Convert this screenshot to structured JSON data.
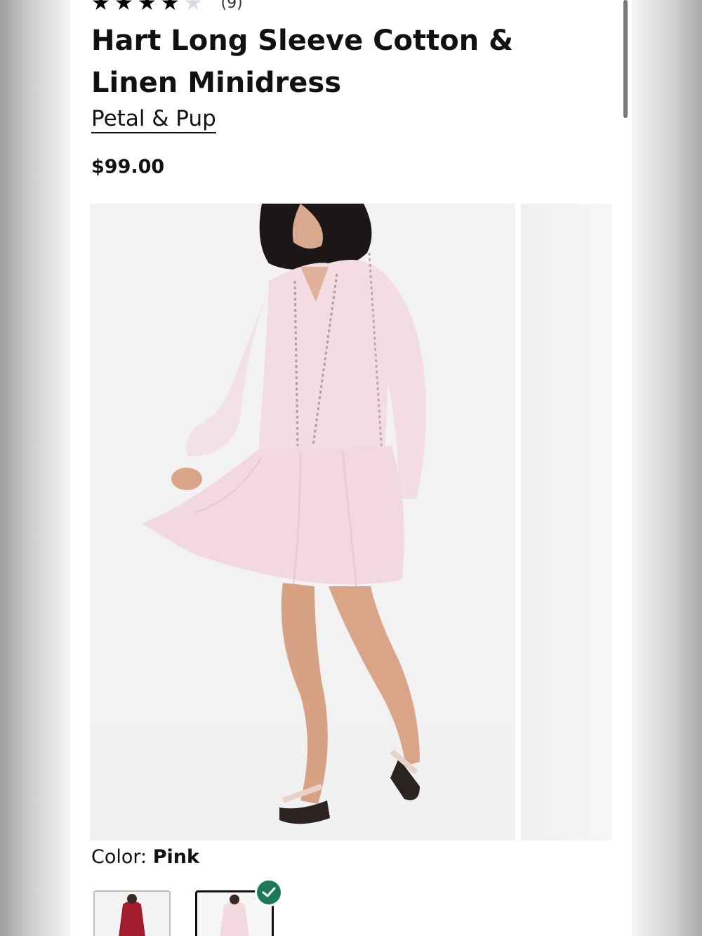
{
  "product": {
    "rating": {
      "value": 4,
      "max": 5,
      "count_text": "(9)"
    },
    "title": "Hart Long Sleeve Cotton & Linen Minidress",
    "brand": "Petal & Pup",
    "price": "$99.00"
  },
  "color": {
    "label": "Color:",
    "selected": "Pink",
    "swatches": [
      {
        "name": "red",
        "color": "#a21c2e"
      },
      {
        "name": "pink",
        "color": "#f2d9df",
        "selected": true
      }
    ]
  },
  "colors": {
    "check_badge": "#1c7a5a",
    "dress": "#f3dde3"
  },
  "icons": {
    "star": "star-icon",
    "check": "check-icon"
  }
}
